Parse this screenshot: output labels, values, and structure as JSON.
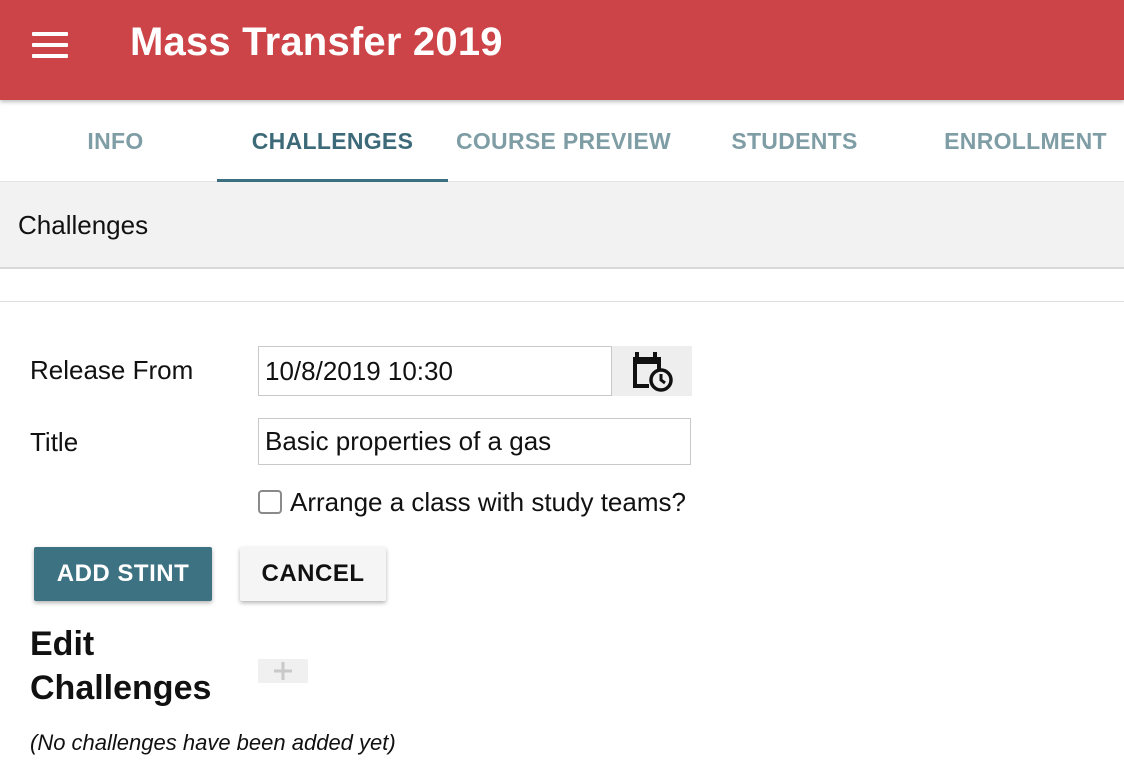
{
  "app": {
    "title": "Mass Transfer 2019",
    "brand_color": "#cc4447",
    "accent_color": "#3d7282",
    "menu_icon": "hamburger-menu-icon"
  },
  "tabs": [
    {
      "label": "INFO",
      "active": false
    },
    {
      "label": "CHALLENGES",
      "active": true
    },
    {
      "label": "COURSE PREVIEW",
      "active": false
    },
    {
      "label": "STUDENTS",
      "active": false
    },
    {
      "label": "ENROLLMENT",
      "active": false
    }
  ],
  "section": {
    "title": "Challenges"
  },
  "form": {
    "release_from_label": "Release From",
    "release_from_value": "10/8/2019 10:30",
    "calendar_icon": "calendar-clock-icon",
    "title_label": "Title",
    "title_value": "Basic properties of a gas",
    "study_teams_label": "Arrange a class with study teams?",
    "study_teams_checked": false,
    "add_button": "ADD STINT",
    "cancel_button": "CANCEL"
  },
  "edit_challenges": {
    "heading": "Edit Challenges",
    "add_icon": "plus-icon",
    "empty_message": "(No challenges have been added yet)"
  }
}
